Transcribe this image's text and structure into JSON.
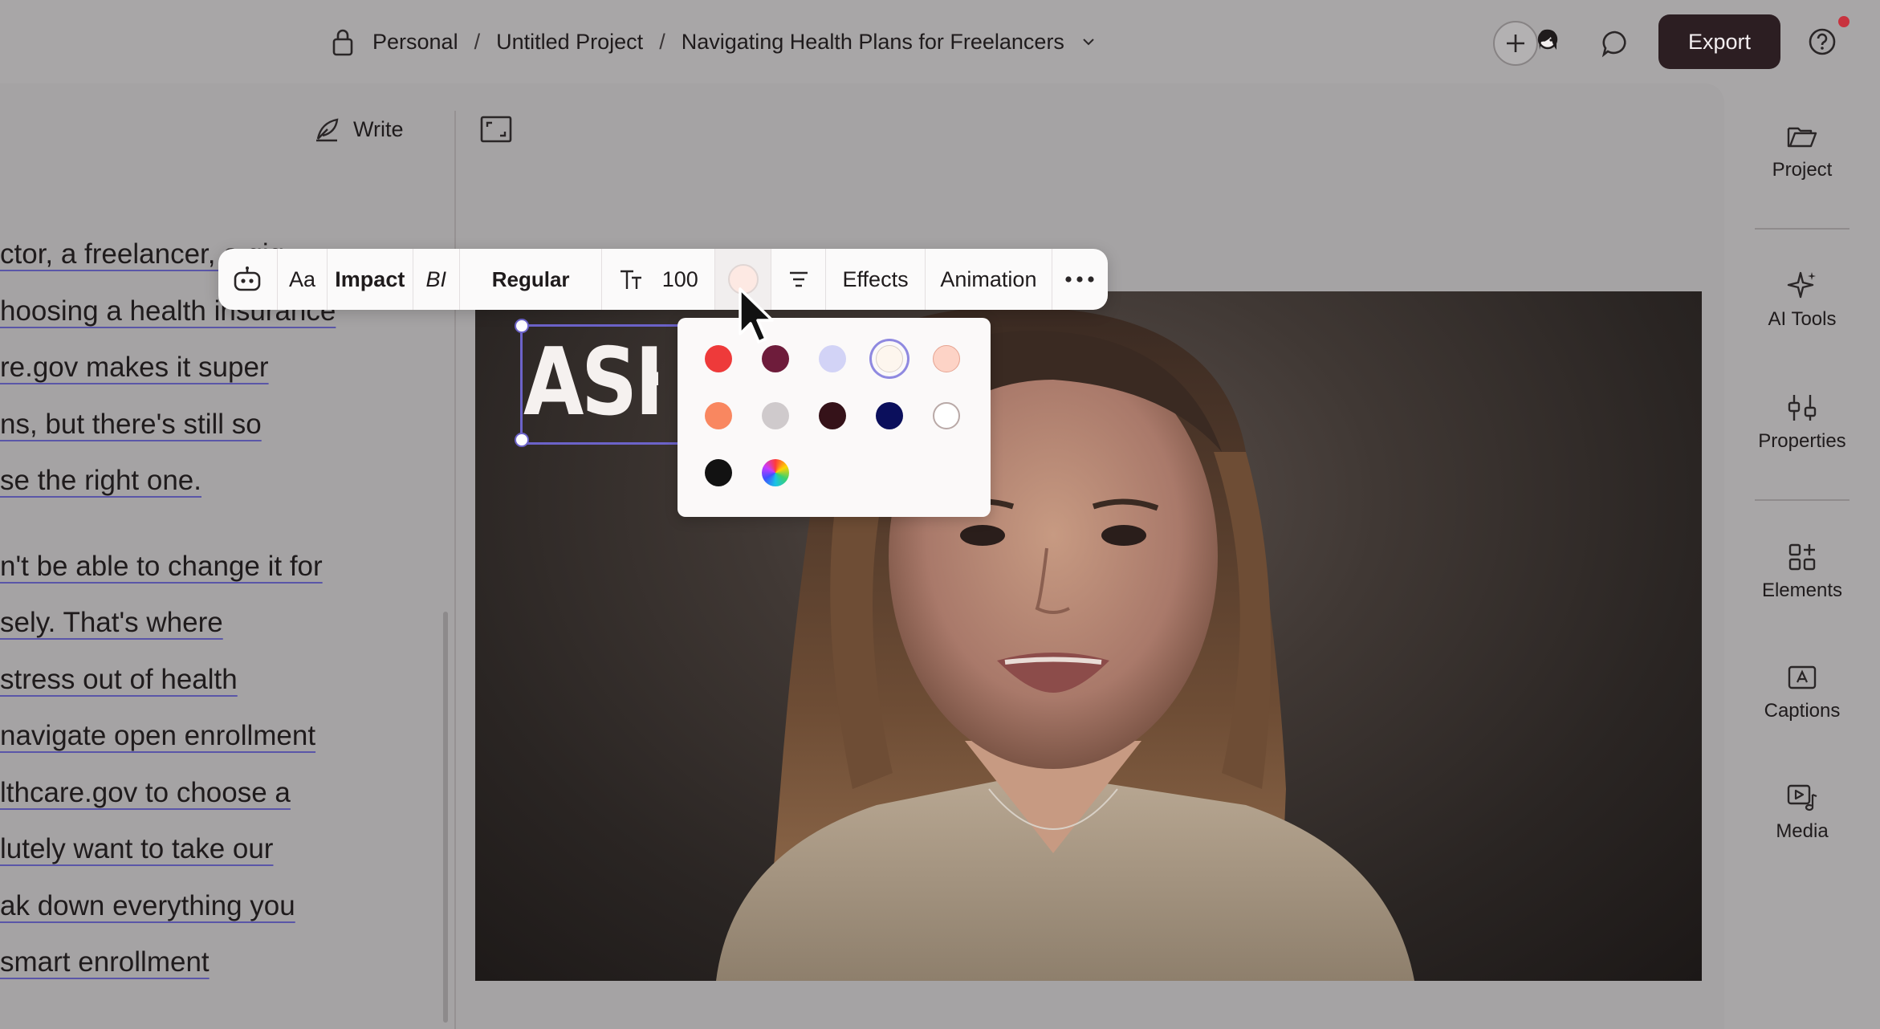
{
  "breadcrumb": {
    "workspace": "Personal",
    "separator": "/",
    "project": "Untitled Project",
    "document": "Navigating Health Plans for Freelancers"
  },
  "header": {
    "export_label": "Export"
  },
  "editor": {
    "write_label": "Write"
  },
  "transcript": {
    "paragraph1": [
      "ctor, a freelancer, a gig",
      "hoosing a health insurance",
      "re.gov makes it super",
      "ns, but there's still so",
      "se the right one."
    ],
    "paragraph2": [
      "n't be able to change it for",
      "sely. That's where",
      "stress out of health",
      "navigate open enrollment",
      "lthcare.gov to choose a",
      "lutely want to take our",
      "ak down everything you",
      " smart enrollment"
    ]
  },
  "text_toolbar": {
    "font_case_label": "Aa",
    "font_family": "Impact",
    "style_icon_label": "BI",
    "font_weight": "Regular",
    "font_size": "100",
    "effects_label": "Effects",
    "animation_label": "Animation",
    "selected_color": "#fde9e3"
  },
  "canvas": {
    "title_text": "ASH"
  },
  "color_palette": {
    "colors": [
      "#ee3a3a",
      "#6e1c3b",
      "#d2d3f6",
      "#fdf6ee",
      "#fdd3c6",
      "#f98760",
      "#cfcacc",
      "#351219",
      "#0b0f5c",
      "#ffffff",
      "#121212"
    ],
    "selected_color": "#fdf6ee"
  },
  "right_rail": {
    "items": [
      {
        "label": "Project",
        "icon": "folder-icon"
      },
      {
        "label": "AI Tools",
        "icon": "sparkle-icon"
      },
      {
        "label": "Properties",
        "icon": "sliders-icon"
      },
      {
        "label": "Elements",
        "icon": "shapes-icon"
      },
      {
        "label": "Captions",
        "icon": "captions-icon"
      },
      {
        "label": "Media",
        "icon": "media-icon"
      }
    ]
  }
}
